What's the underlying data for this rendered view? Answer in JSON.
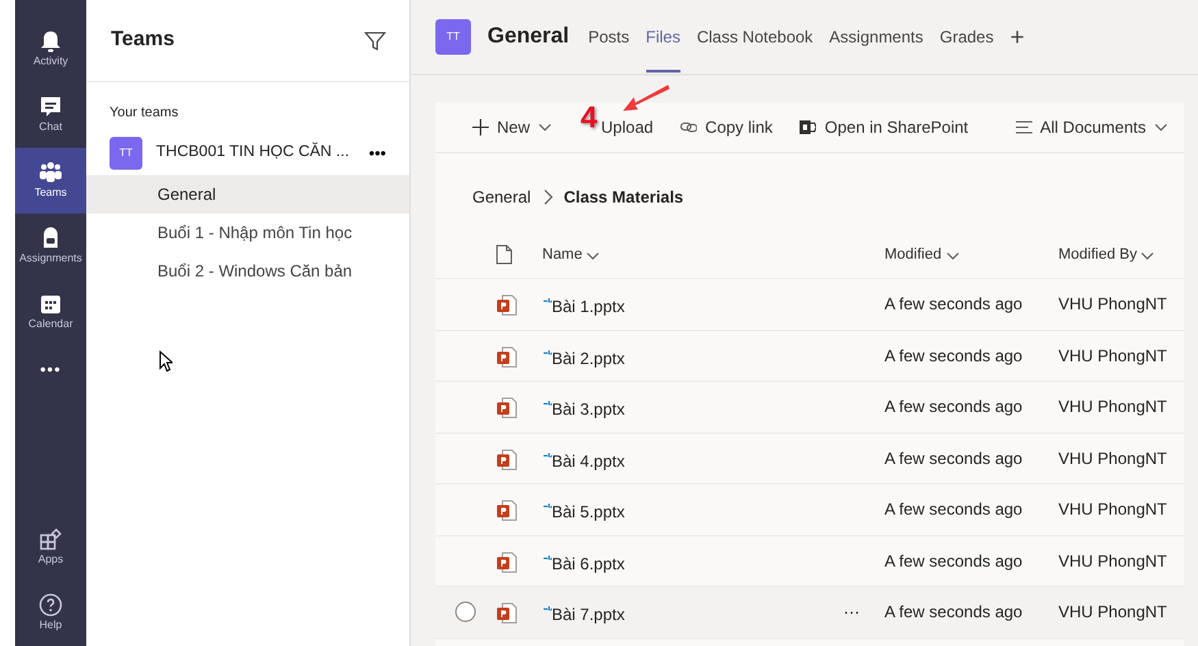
{
  "rail": {
    "items": [
      {
        "label": "Activity",
        "selected": false
      },
      {
        "label": "Chat",
        "selected": false
      },
      {
        "label": "Teams",
        "selected": true
      },
      {
        "label": "Assignments",
        "selected": false
      },
      {
        "label": "Calendar",
        "selected": false
      }
    ],
    "more": "•••",
    "bottom_items": [
      {
        "label": "Apps"
      },
      {
        "label": "Help"
      }
    ]
  },
  "teams_panel": {
    "title": "Teams",
    "section": "Your teams",
    "team": {
      "avatar": "TT",
      "name": "THCB001 TIN HỌC CĂN ...",
      "more": "•••"
    },
    "channels": [
      {
        "label": "General",
        "selected": true
      },
      {
        "label": "Buổi 1 - Nhập môn Tin học",
        "selected": false
      },
      {
        "label": "Buổi 2 - Windows Căn bản",
        "selected": false
      }
    ]
  },
  "header": {
    "avatar": "TT",
    "title": "General",
    "tabs": [
      {
        "label": "Posts",
        "selected": false
      },
      {
        "label": "Files",
        "selected": true
      },
      {
        "label": "Class Notebook",
        "selected": false
      },
      {
        "label": "Assignments",
        "selected": false
      },
      {
        "label": "Grades",
        "selected": false
      }
    ],
    "add": "+"
  },
  "toolbar": {
    "items": [
      {
        "kind": "new",
        "label": "New"
      },
      {
        "kind": "upload",
        "label": "Upload"
      },
      {
        "kind": "link",
        "label": "Copy link"
      },
      {
        "kind": "sharepoint",
        "label": "Open in SharePoint"
      }
    ],
    "view": "All Documents"
  },
  "annotation": {
    "number": "4"
  },
  "breadcrumb": [
    "General",
    "Class Materials"
  ],
  "table": {
    "columns": [
      "Name",
      "Modified",
      "Modified By"
    ],
    "rows": [
      {
        "name": "Bài 1.pptx",
        "modified": "A few seconds ago",
        "modified_by": "VHU PhongNT",
        "hovered": false
      },
      {
        "name": "Bài 2.pptx",
        "modified": "A few seconds ago",
        "modified_by": "VHU PhongNT",
        "hovered": false
      },
      {
        "name": "Bài 3.pptx",
        "modified": "A few seconds ago",
        "modified_by": "VHU PhongNT",
        "hovered": false
      },
      {
        "name": "Bài 4.pptx",
        "modified": "A few seconds ago",
        "modified_by": "VHU PhongNT",
        "hovered": false
      },
      {
        "name": "Bài 5.pptx",
        "modified": "A few seconds ago",
        "modified_by": "VHU PhongNT",
        "hovered": false
      },
      {
        "name": "Bài 6.pptx",
        "modified": "A few seconds ago",
        "modified_by": "VHU PhongNT",
        "hovered": false
      },
      {
        "name": "Bài 7.pptx",
        "modified": "A few seconds ago",
        "modified_by": "VHU PhongNT",
        "hovered": true,
        "more": "···"
      }
    ]
  }
}
